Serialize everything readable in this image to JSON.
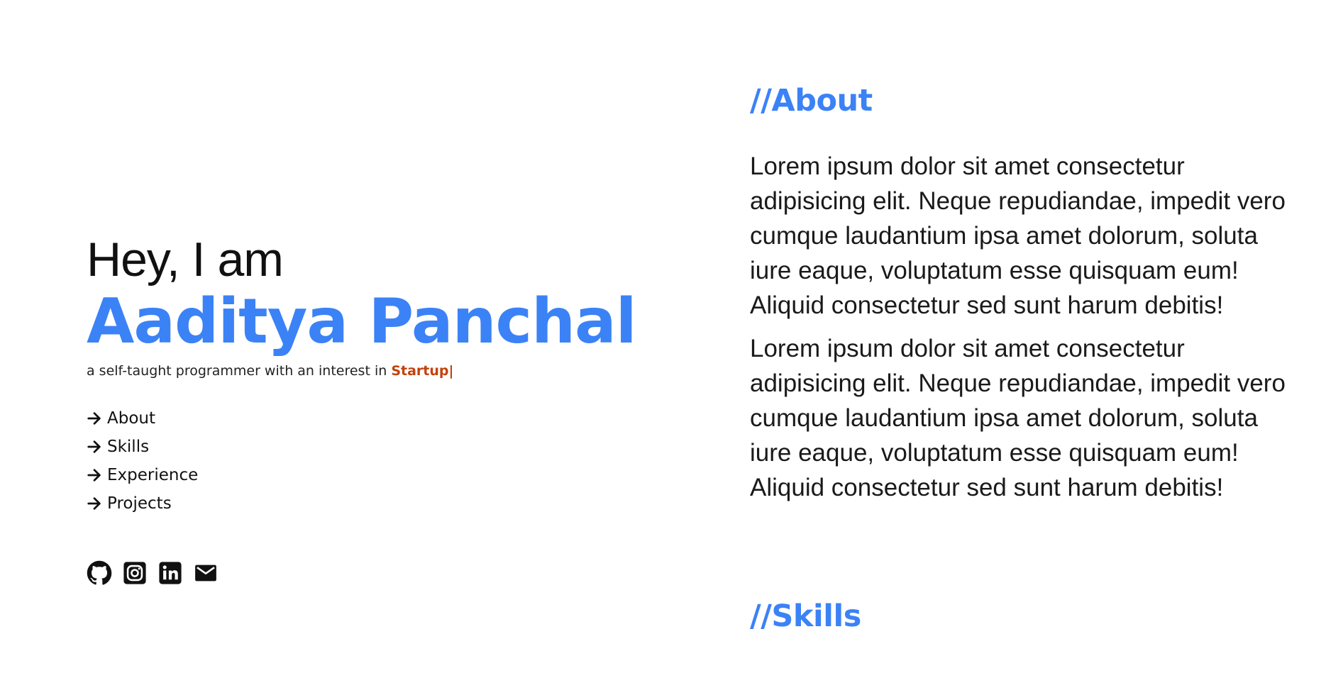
{
  "hero": {
    "greeting": "Hey, I am",
    "name": "Aaditya Panchal",
    "tagline_prefix": "a self-taught programmer with an interest in ",
    "tagline_interest": "Startup",
    "tagline_cursor": "|"
  },
  "nav": {
    "items": [
      {
        "label": "About",
        "icon": "arrow-right-icon"
      },
      {
        "label": "Skills",
        "icon": "arrow-right-icon"
      },
      {
        "label": "Experience",
        "icon": "arrow-right-icon"
      },
      {
        "label": "Projects",
        "icon": "arrow-right-icon"
      }
    ]
  },
  "socials": {
    "items": [
      {
        "icon": "github-icon"
      },
      {
        "icon": "instagram-icon"
      },
      {
        "icon": "linkedin-icon"
      },
      {
        "icon": "email-icon"
      }
    ]
  },
  "about": {
    "title": "//About",
    "paragraphs": [
      "Lorem ipsum dolor sit amet consectetur adipisicing elit. Neque repudiandae, impedit vero cumque laudantium ipsa amet dolorum, soluta iure eaque, voluptatum esse quisquam eum! Aliquid consectetur sed sunt harum debitis!",
      "Lorem ipsum dolor sit amet consectetur adipisicing elit. Neque repudiandae, impedit vero cumque laudantium ipsa amet dolorum, soluta iure eaque, voluptatum esse quisquam eum! Aliquid consectetur sed sunt harum debitis!"
    ]
  },
  "skills": {
    "title": "//Skills"
  },
  "colors": {
    "accent": "#3b82f6",
    "highlight": "#c2410c",
    "text": "#111111",
    "background": "#ffffff"
  }
}
